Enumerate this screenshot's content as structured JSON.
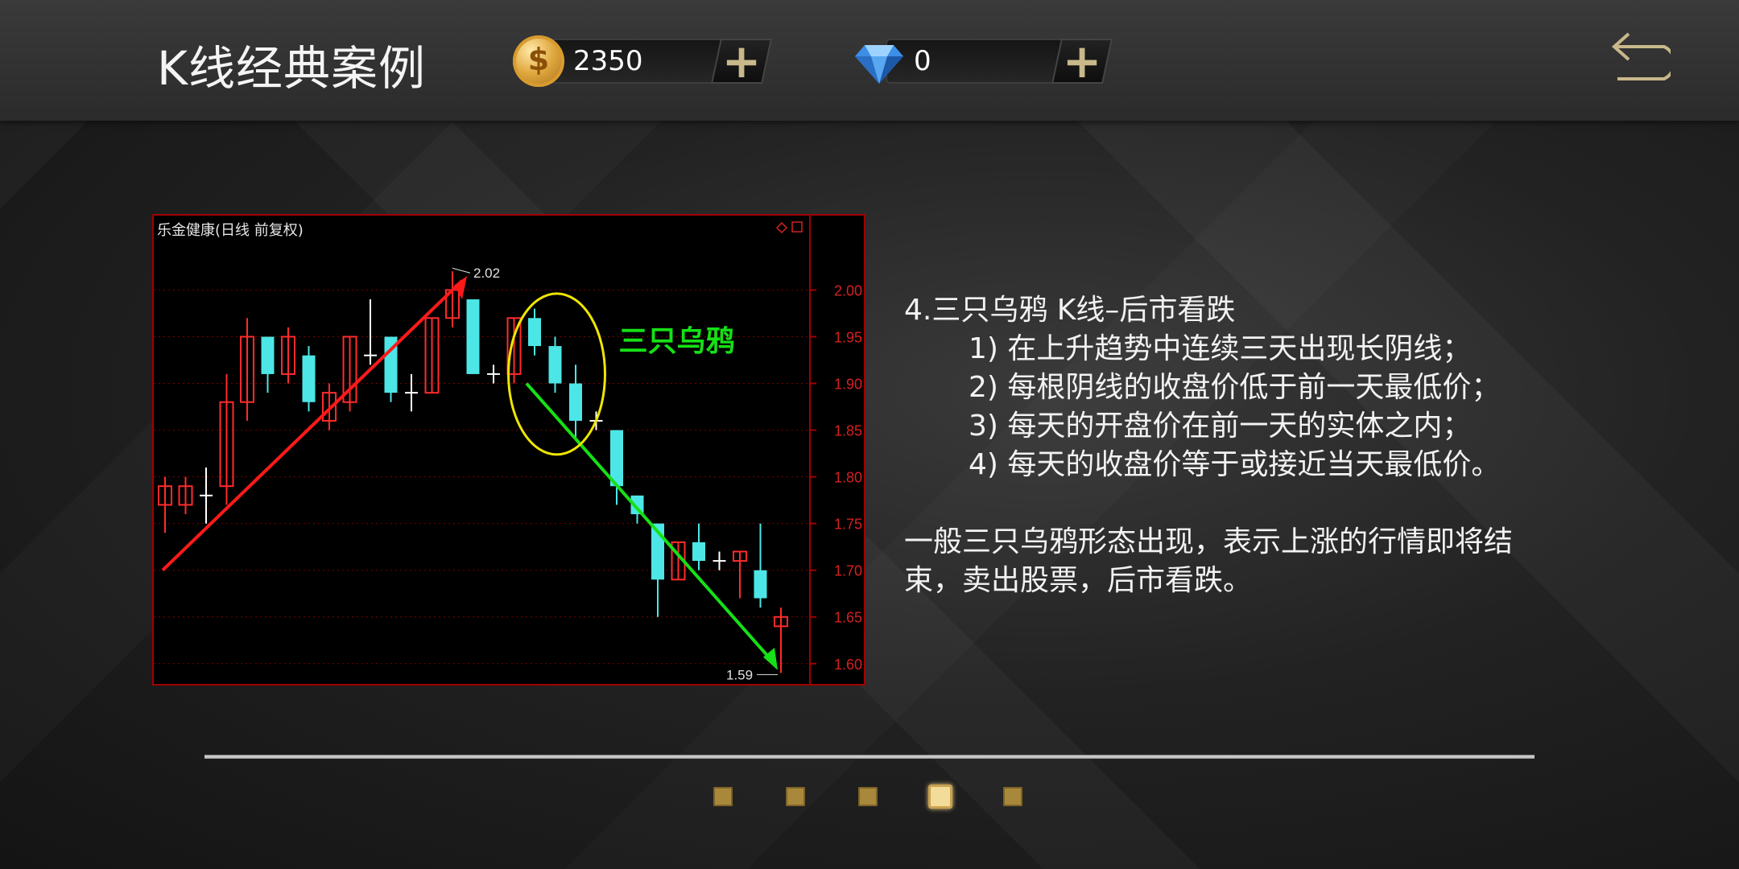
{
  "header": {
    "title": "K线经典案例",
    "coins": {
      "value": "2350",
      "icon": "coin-icon",
      "add_label": "+"
    },
    "diamonds": {
      "value": "0",
      "icon": "diamond-icon",
      "add_label": "+"
    },
    "back_icon": "back-arrow-icon"
  },
  "chart": {
    "stock_label": "乐金健康(日线 前复权)",
    "pattern_label": "三只乌鸦",
    "high_label": "2.02",
    "low_label": "1.59"
  },
  "chart_data": {
    "type": "candlestick",
    "ylim": [
      1.58,
      2.04
    ],
    "y_ticks": [
      "2.00",
      "1.95",
      "1.90",
      "1.85",
      "1.80",
      "1.75",
      "1.70",
      "1.65",
      "1.60"
    ],
    "candles": [
      {
        "o": 1.77,
        "h": 1.8,
        "l": 1.74,
        "c": 1.79
      },
      {
        "o": 1.77,
        "h": 1.8,
        "l": 1.76,
        "c": 1.79
      },
      {
        "o": 1.78,
        "h": 1.81,
        "l": 1.75,
        "c": 1.78
      },
      {
        "o": 1.79,
        "h": 1.91,
        "l": 1.77,
        "c": 1.88
      },
      {
        "o": 1.88,
        "h": 1.97,
        "l": 1.86,
        "c": 1.95
      },
      {
        "o": 1.95,
        "h": 1.95,
        "l": 1.89,
        "c": 1.91
      },
      {
        "o": 1.91,
        "h": 1.96,
        "l": 1.9,
        "c": 1.95
      },
      {
        "o": 1.93,
        "h": 1.94,
        "l": 1.87,
        "c": 1.88
      },
      {
        "o": 1.86,
        "h": 1.9,
        "l": 1.85,
        "c": 1.89
      },
      {
        "o": 1.88,
        "h": 1.95,
        "l": 1.87,
        "c": 1.95
      },
      {
        "o": 1.93,
        "h": 1.99,
        "l": 1.92,
        "c": 1.93
      },
      {
        "o": 1.95,
        "h": 1.95,
        "l": 1.88,
        "c": 1.89
      },
      {
        "o": 1.89,
        "h": 1.91,
        "l": 1.87,
        "c": 1.89
      },
      {
        "o": 1.89,
        "h": 1.97,
        "l": 1.89,
        "c": 1.97
      },
      {
        "o": 1.97,
        "h": 2.02,
        "l": 1.96,
        "c": 2.0
      },
      {
        "o": 1.99,
        "h": 1.99,
        "l": 1.91,
        "c": 1.91
      },
      {
        "o": 1.91,
        "h": 1.92,
        "l": 1.9,
        "c": 1.91
      },
      {
        "o": 1.91,
        "h": 1.97,
        "l": 1.9,
        "c": 1.97
      },
      {
        "o": 1.97,
        "h": 1.98,
        "l": 1.93,
        "c": 1.94
      },
      {
        "o": 1.94,
        "h": 1.95,
        "l": 1.89,
        "c": 1.9
      },
      {
        "o": 1.9,
        "h": 1.92,
        "l": 1.84,
        "c": 1.86
      },
      {
        "o": 1.86,
        "h": 1.87,
        "l": 1.85,
        "c": 1.86
      },
      {
        "o": 1.85,
        "h": 1.85,
        "l": 1.77,
        "c": 1.79
      },
      {
        "o": 1.78,
        "h": 1.78,
        "l": 1.75,
        "c": 1.76
      },
      {
        "o": 1.75,
        "h": 1.75,
        "l": 1.65,
        "c": 1.69
      },
      {
        "o": 1.69,
        "h": 1.73,
        "l": 1.69,
        "c": 1.73
      },
      {
        "o": 1.73,
        "h": 1.75,
        "l": 1.7,
        "c": 1.71
      },
      {
        "o": 1.71,
        "h": 1.72,
        "l": 1.7,
        "c": 1.71
      },
      {
        "o": 1.71,
        "h": 1.72,
        "l": 1.67,
        "c": 1.72
      },
      {
        "o": 1.7,
        "h": 1.75,
        "l": 1.66,
        "c": 1.67
      },
      {
        "o": 1.64,
        "h": 1.66,
        "l": 1.59,
        "c": 1.65
      }
    ]
  },
  "description": {
    "heading": "4.三只乌鸦 K线–后市看跌",
    "items": [
      "1) 在上升趋势中连续三天出现长阴线；",
      "2) 每根阴线的收盘价低于前一天最低价；",
      "3) 每天的开盘价在前一天的实体之内；",
      "4) 每天的收盘价等于或接近当天最低价。"
    ],
    "summary_line1": "一般三只乌鸦形态出现，表示上涨的行情即将结",
    "summary_line2": "束，卖出股票，后市看跌。"
  },
  "pagination": {
    "count": 5,
    "active_index": 3
  },
  "colors": {
    "up": "#ff2b2b",
    "down": "#4de6e6",
    "trend_up": "#ff1a1a",
    "trend_down": "#16e016",
    "ellipse": "#f0e600",
    "accent_gold": "#c8b88a"
  }
}
